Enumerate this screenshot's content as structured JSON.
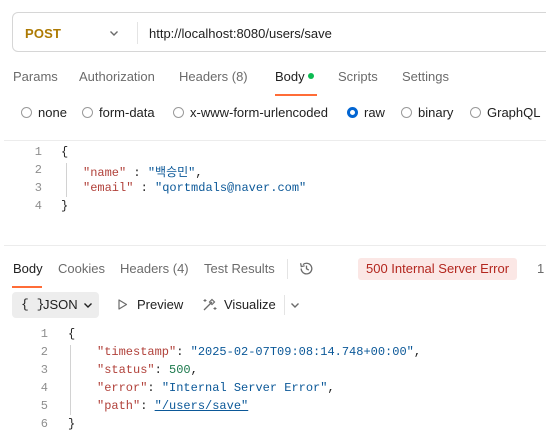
{
  "request": {
    "method": "POST",
    "url": "http://localhost:8080/users/save",
    "tabs": [
      "Params",
      "Authorization",
      "Headers (8)",
      "Body",
      "Scripts",
      "Settings"
    ],
    "body_types": [
      "none",
      "form-data",
      "x-www-form-urlencoded",
      "raw",
      "binary",
      "GraphQL"
    ],
    "selected_body_type": "raw",
    "body": {
      "line_numbers": [
        "1",
        "2",
        "3",
        "4"
      ],
      "open_brace": "{",
      "close_brace": "}",
      "name_key": "\"name\"",
      "name_sep": " : ",
      "name_value": "\"백승민\"",
      "name_comma": ",",
      "email_key": "\"email\"",
      "email_sep": " : ",
      "email_value": "\"qortmdals@naver.com\""
    }
  },
  "response": {
    "tabs": [
      "Body",
      "Cookies",
      "Headers (4)",
      "Test Results"
    ],
    "status": "500 Internal Server Error",
    "status_extra": "1",
    "format": "JSON",
    "format_icon": "{ }",
    "preview_label": "Preview",
    "visualize_label": "Visualize",
    "body": {
      "line_numbers": [
        "1",
        "2",
        "3",
        "4",
        "5",
        "6"
      ],
      "open_brace": "{",
      "close_brace": "}",
      "timestamp_key": "\"timestamp\"",
      "timestamp_value": "\"2025-02-07T09:08:14.748+00:00\"",
      "status_key": "\"status\"",
      "status_value": "500",
      "error_key": "\"error\"",
      "error_value": "\"Internal Server Error\"",
      "path_key": "\"path\"",
      "path_value": "\"/users/save\"",
      "colon": ": ",
      "comma": ","
    }
  },
  "icons": {
    "method_dropdown": "chevron-down-icon",
    "history": "history-icon",
    "preview": "play-icon",
    "visualize": "visualize-icon"
  },
  "colors": {
    "method": "#ad7a03",
    "accent": "#ff6c37",
    "radio_selected": "#0265d2",
    "body_indicator": "#0cbb52",
    "error_status": "#b3261e"
  }
}
